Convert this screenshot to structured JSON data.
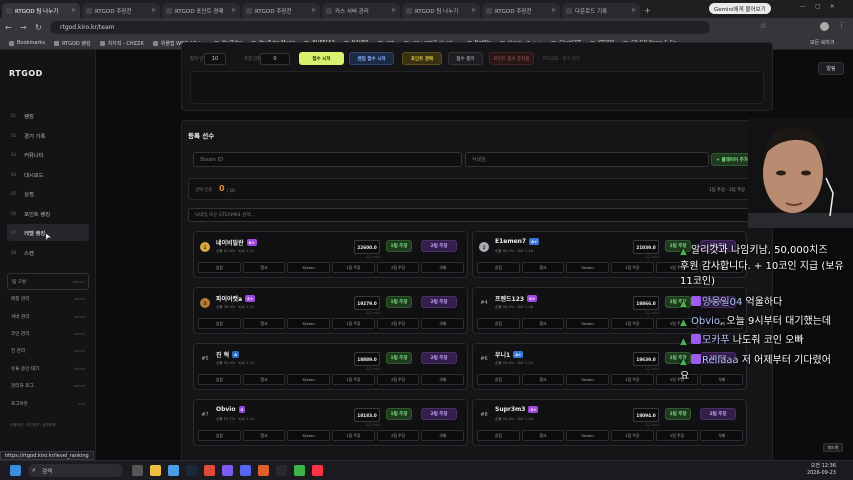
{
  "browser": {
    "tabs": [
      {
        "label": "RTGOD 팀 나누기",
        "active": true
      },
      {
        "label": "RTGOD 주장전"
      },
      {
        "label": "RTGOD 포인트 경매"
      },
      {
        "label": "RTGOD 주장전"
      },
      {
        "label": "카스 서버 관리"
      },
      {
        "label": "RTGOD 팀 나누기"
      },
      {
        "label": "RTGOD 주장전"
      },
      {
        "label": "다운로드 기록"
      }
    ],
    "gemini_label": "Gemini에게 물어보기",
    "url": "rtgod.kiro.kr/team",
    "bookmarks": [
      "Bookmarks",
      "RTGOD 랭킹",
      "치지직 - CHZZK",
      "위플랩 WEFLAB |...",
      "YouTube",
      "YouTube Music",
      "BUFF163",
      "NAVER",
      "쿠팡",
      "(31) 강병중 대시보...",
      "Netflix",
      "알리갓 - Twitch",
      "ChatGPT",
      "YTORY",
      "CS:GO News & Co..."
    ],
    "all_bookmarks": "모든 북마크"
  },
  "app": {
    "logo": "RTGOD",
    "nav": [
      {
        "num": "01",
        "label": "랭킹"
      },
      {
        "num": "02",
        "label": "경기 기록"
      },
      {
        "num": "03",
        "label": "커뮤니티"
      },
      {
        "num": "04",
        "label": "대시보드"
      },
      {
        "num": "05",
        "label": "상점"
      },
      {
        "num": "06",
        "label": "포인트 랭킹"
      },
      {
        "num": "07",
        "label": "레벨 랭킹",
        "active": true
      },
      {
        "num": "08",
        "label": "스캔"
      }
    ],
    "admin_nav": [
      {
        "label": "팀 구성",
        "tag": "admin"
      },
      {
        "label": "매칭 관리",
        "tag": "admin"
      },
      {
        "label": "서버 관리",
        "tag": "admin"
      },
      {
        "label": "코인 관리",
        "tag": "admin"
      },
      {
        "label": "전 관리",
        "tag": "admin"
      },
      {
        "label": "유튜 승인 대기",
        "tag": "admin"
      },
      {
        "label": "관리자 로그",
        "tag": "admin"
      },
      {
        "label": "로그아웃",
        "tag": "exit"
      }
    ],
    "footer": "이용약관 · 개인정보 · 운영정책",
    "notify": "알림",
    "controls": {
      "label_a": "참가 인원",
      "value_a": "10",
      "label_b": "주장 인원",
      "value_b": "0",
      "start": "접수 시작",
      "random_start": "랜덤 접수 시작",
      "point_auction": "포인트 경매",
      "stop": "접수 중지",
      "point_status": "포인트 접수 중지됨",
      "caption": "RTGOD · 접수 대기"
    },
    "registered": {
      "title": "등록 선수",
      "steam_placeholder": "Steam ID",
      "nick_placeholder": "닉네임",
      "add_button": "+ 플레이어 추가",
      "count_label": "선택 인원",
      "count_value": "0",
      "count_total": "/ 10",
      "right_label": "1팀 주장 · 2팀 주장",
      "search_placeholder": "닉네임 또는 STEAM64 검색..."
    },
    "players": [
      {
        "rank": "1",
        "medal": "gold",
        "name": "네이비밀란",
        "tier": "S+",
        "stat": "승률 61.8% · K/D 1.21",
        "score": "22600.0",
        "side": "left"
      },
      {
        "rank": "2",
        "medal": "silver",
        "name": "E1emen7",
        "tier": "A+",
        "stat": "승률 60.2% · K/D 1.18",
        "score": "21039.0",
        "side": "right"
      },
      {
        "rank": "3",
        "medal": "bronze",
        "name": "파이어캣a",
        "tier": "S+",
        "stat": "승률 58.9% · K/D 1.11",
        "score": "19279.0",
        "side": "left"
      },
      {
        "rank": "#4",
        "medal": "",
        "name": "프렌드123",
        "tier": "S+",
        "stat": "승률 56.4% · K/D 1.08",
        "score": "18866.0",
        "side": "right"
      },
      {
        "rank": "#5",
        "medal": "",
        "name": "진 혁",
        "tier": "A",
        "stat": "승률 55.9% · K/D 1.15",
        "score": "18889.0",
        "side": "left"
      },
      {
        "rank": "#6",
        "medal": "",
        "name": "부니1",
        "tier": "A+",
        "stat": "승률 54.8% · K/D 1.12",
        "score": "18639.0",
        "side": "right"
      },
      {
        "rank": "#7",
        "medal": "",
        "name": "Obvio",
        "tier": "S",
        "stat": "승률 53.7% · K/D 1.10",
        "score": "18183.0",
        "side": "left"
      },
      {
        "rank": "#8",
        "medal": "",
        "name": "Supr3m3",
        "tier": "S+",
        "stat": "승률 52.4% · K/D 1.04",
        "score": "18094.0",
        "side": "right"
      }
    ],
    "card_buttons": {
      "captain1": "1팀 주장",
      "captain2": "2팀 주장",
      "side_note": "최근 20경기",
      "cells": [
        "승점",
        "랭크",
        "Steam",
        "1팀 주장",
        "2팀 주장",
        "삭제"
      ]
    },
    "feedback": "피드백"
  },
  "stream_chat": [
    {
      "icon": "tri",
      "user": "",
      "text": "알리갓과 나임키남, 50,000치즈"
    },
    {
      "icon": "none",
      "user": "",
      "text": "후원 감사합니다. + 10코인 지급 (보유"
    },
    {
      "icon": "none",
      "user": "",
      "text": "11코인)"
    },
    {
      "icon": "tri-heart",
      "user": "양웅일04",
      "text": "억울하다"
    },
    {
      "icon": "tri",
      "user": "Obvio,",
      "text": "오늘 9시부터 대기했는데"
    },
    {
      "icon": "tri-heart",
      "user": "모카푸",
      "text": "나도줘 코인 오빠"
    },
    {
      "icon": "tri-heart",
      "user": "Rellaaa",
      "text": "저 어제부터 기다렸어"
    },
    {
      "icon": "none",
      "user": "",
      "text": "요"
    }
  ],
  "status_url": "https://rtgod.kiro.kr/level_ranking",
  "taskbar": {
    "search": "검색",
    "time": "오전 12:36",
    "date": "2026-09-23"
  }
}
